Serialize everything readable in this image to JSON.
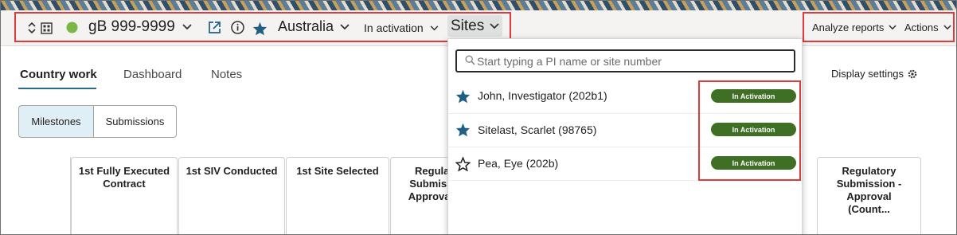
{
  "header": {
    "record_id": "gB 999-9999",
    "country": "Australia",
    "status": "In activation",
    "sites_label": "Sites",
    "analyze_reports": "Analyze reports",
    "actions": "Actions",
    "status_dot_color": "#7ab648",
    "star_color": "#1f5f84",
    "highlight_color": "#e03a3a"
  },
  "tabs": [
    {
      "label": "Country work",
      "active": true
    },
    {
      "label": "Dashboard",
      "active": false
    },
    {
      "label": "Notes",
      "active": false
    }
  ],
  "display_settings": "Display settings",
  "segments": [
    {
      "label": "Milestones",
      "selected": true
    },
    {
      "label": "Submissions",
      "selected": false
    }
  ],
  "columns": [
    {
      "label": "1st Fully Executed Contract"
    },
    {
      "label": "1st SIV Conducted"
    },
    {
      "label": "1st Site Selected"
    },
    {
      "label": "Regulatory Submission - Approval (C..."
    },
    {
      "label": "Regulatory Submission - Approval (Count..."
    }
  ],
  "sites_dropdown": {
    "search_placeholder": "Start typing a PI name or site number",
    "items": [
      {
        "name": "John, Investigator (202b1)",
        "favorite": true,
        "status": "In Activation"
      },
      {
        "name": "Sitelast, Scarlet (98765)",
        "favorite": true,
        "status": "In Activation"
      },
      {
        "name": "Pea, Eye (202b)",
        "favorite": false,
        "status": "In Activation"
      }
    ],
    "badge_color": "#3f6f25"
  }
}
